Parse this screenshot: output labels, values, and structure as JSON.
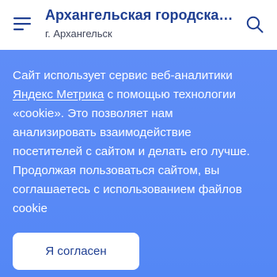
{
  "header": {
    "title": "Архангельская городская ...",
    "subtitle": "г. Архангельск",
    "menu_icon": "hamburger-menu-icon",
    "search_icon": "search-icon",
    "title_color": "#1f3f92",
    "icon_color": "#1f3f92"
  },
  "cookie_banner": {
    "background_color": "#5b8af6",
    "line1": "Сайт использует сервис веб-аналитики",
    "link_text": "Яндекс Метрика",
    "line2_rest": " с помощью технологии",
    "line3": "«cookie». Это позволяет нам",
    "line4": "анализировать взаимодействие",
    "line5": "посетителей с сайтом и делать его лучше.",
    "line6": "Продолжая пользоваться сайтом, вы",
    "line7": "соглашаетесь с использованием файлов",
    "line8": "cookie",
    "button_label": "Я согласен"
  }
}
